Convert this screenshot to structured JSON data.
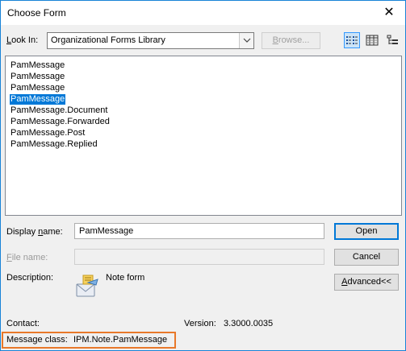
{
  "window": {
    "title": "Choose Form",
    "close_glyph": "✕"
  },
  "look_in": {
    "label_accel": "L",
    "label_rest": "ook In:",
    "selected": "Organizational Forms Library",
    "browse_accel": "B",
    "browse_rest": "rowse..."
  },
  "view_buttons": [
    "list-view-icon",
    "details-view-icon",
    "properties-view-icon"
  ],
  "forms": [
    "PamMessage",
    "PamMessage",
    "PamMessage",
    "PamMessage",
    "PamMessage.Document",
    "PamMessage.Forwarded",
    "PamMessage.Post",
    "PamMessage.Replied"
  ],
  "selected_index": 3,
  "display_name": {
    "label_pre": "Display ",
    "label_accel": "n",
    "label_post": "ame:",
    "value": "PamMessage"
  },
  "file_name": {
    "label_accel": "F",
    "label_rest": "ile name:",
    "value": ""
  },
  "description": {
    "label": "Description:",
    "value": "Note form",
    "icon": "note-form-icon"
  },
  "buttons": {
    "open": "Open",
    "cancel": "Cancel",
    "advanced_accel": "A",
    "advanced_rest": "dvanced<<"
  },
  "contact": {
    "label": "Contact:",
    "value": ""
  },
  "version": {
    "label": "Version:",
    "value": "3.3000.0035"
  },
  "message_class": {
    "label": "Message class:",
    "value": "IPM.Note.PamMessage"
  },
  "colors": {
    "accent": "#0078d7",
    "highlight_box": "#e8782a"
  }
}
